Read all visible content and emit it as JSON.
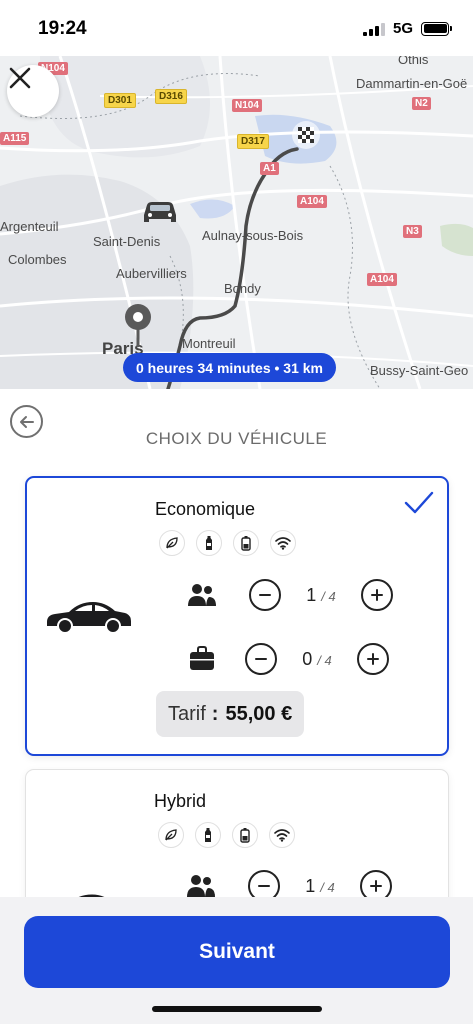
{
  "status_bar": {
    "time": "19:24",
    "network": "5G"
  },
  "map": {
    "places": {
      "paris": "Paris",
      "saint_denis": "Saint-Denis",
      "argenteuil": "Argenteuil",
      "colombes": "Colombes",
      "aubervilliers": "Aubervilliers",
      "aulnay": "Aulnay-sous-Bois",
      "bondy": "Bondy",
      "montreuil": "Montreuil",
      "dammartin": "Dammartin-en-Goë",
      "bussy": "Bussy-Saint-Geo",
      "othis": "Othis"
    },
    "roads": {
      "d301": "D301",
      "d316": "D316",
      "n104": "N104",
      "d317": "D317",
      "a115": "A115",
      "a104_a": "A104",
      "a104_b": "A104",
      "n2": "N2",
      "n3": "N3",
      "a1": "A1",
      "n104_top": "N104"
    },
    "route_summary": "0 heures 34 minutes • 31 km"
  },
  "panel": {
    "title": "CHOIX DU VÉHICULE",
    "vehicles": [
      {
        "name": "Economique",
        "passengers": "1",
        "passengers_max": "/ 4",
        "luggage": "0",
        "luggage_max": "/ 4",
        "price_label": "Tarif",
        "price_separator": ":",
        "price": "55,00 €",
        "selected": true
      },
      {
        "name": "Hybrid",
        "passengers": "1",
        "passengers_max": "/ 4",
        "selected": false
      }
    ]
  },
  "footer": {
    "next_label": "Suivant"
  },
  "colors": {
    "accent": "#1d48d8",
    "route": "#4a4a4a"
  }
}
